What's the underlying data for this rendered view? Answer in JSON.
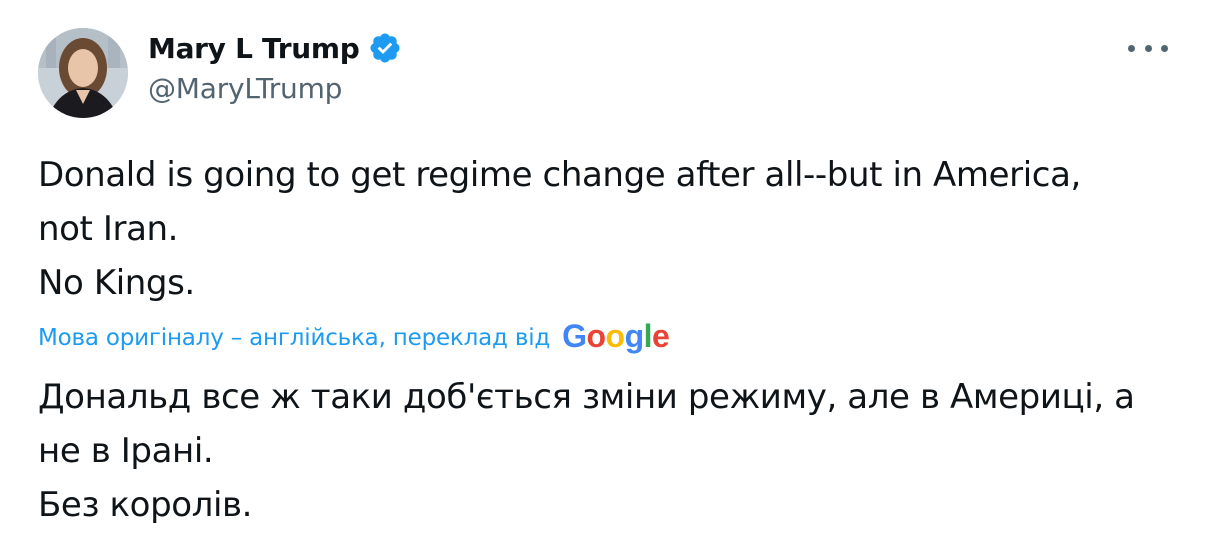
{
  "author": {
    "display_name": "Mary L Trump",
    "handle": "@MaryLTrump",
    "verified": true,
    "avatar_icon": "profile-photo"
  },
  "menu": {
    "icon": "more-horizontal-icon"
  },
  "tweet": {
    "lines": [
      "Donald is going to get regime change after all--but in America,",
      "not Iran.",
      "No Kings."
    ]
  },
  "translation": {
    "note": "Мова оригіналу – англійська, переклад від",
    "provider_letters": [
      "G",
      "o",
      "o",
      "g",
      "l",
      "e"
    ],
    "provider_colors": [
      "#4285F4",
      "#EA4335",
      "#FBBC05",
      "#4285F4",
      "#34A853",
      "#EA4335"
    ],
    "lines": [
      "Дональд все ж таки доб'ється зміни режиму, але в Америці, а",
      "не в Ірані.",
      "Без королів."
    ]
  },
  "colors": {
    "accent": "#1d9bf0",
    "text": "#0f1419",
    "muted": "#536471"
  }
}
